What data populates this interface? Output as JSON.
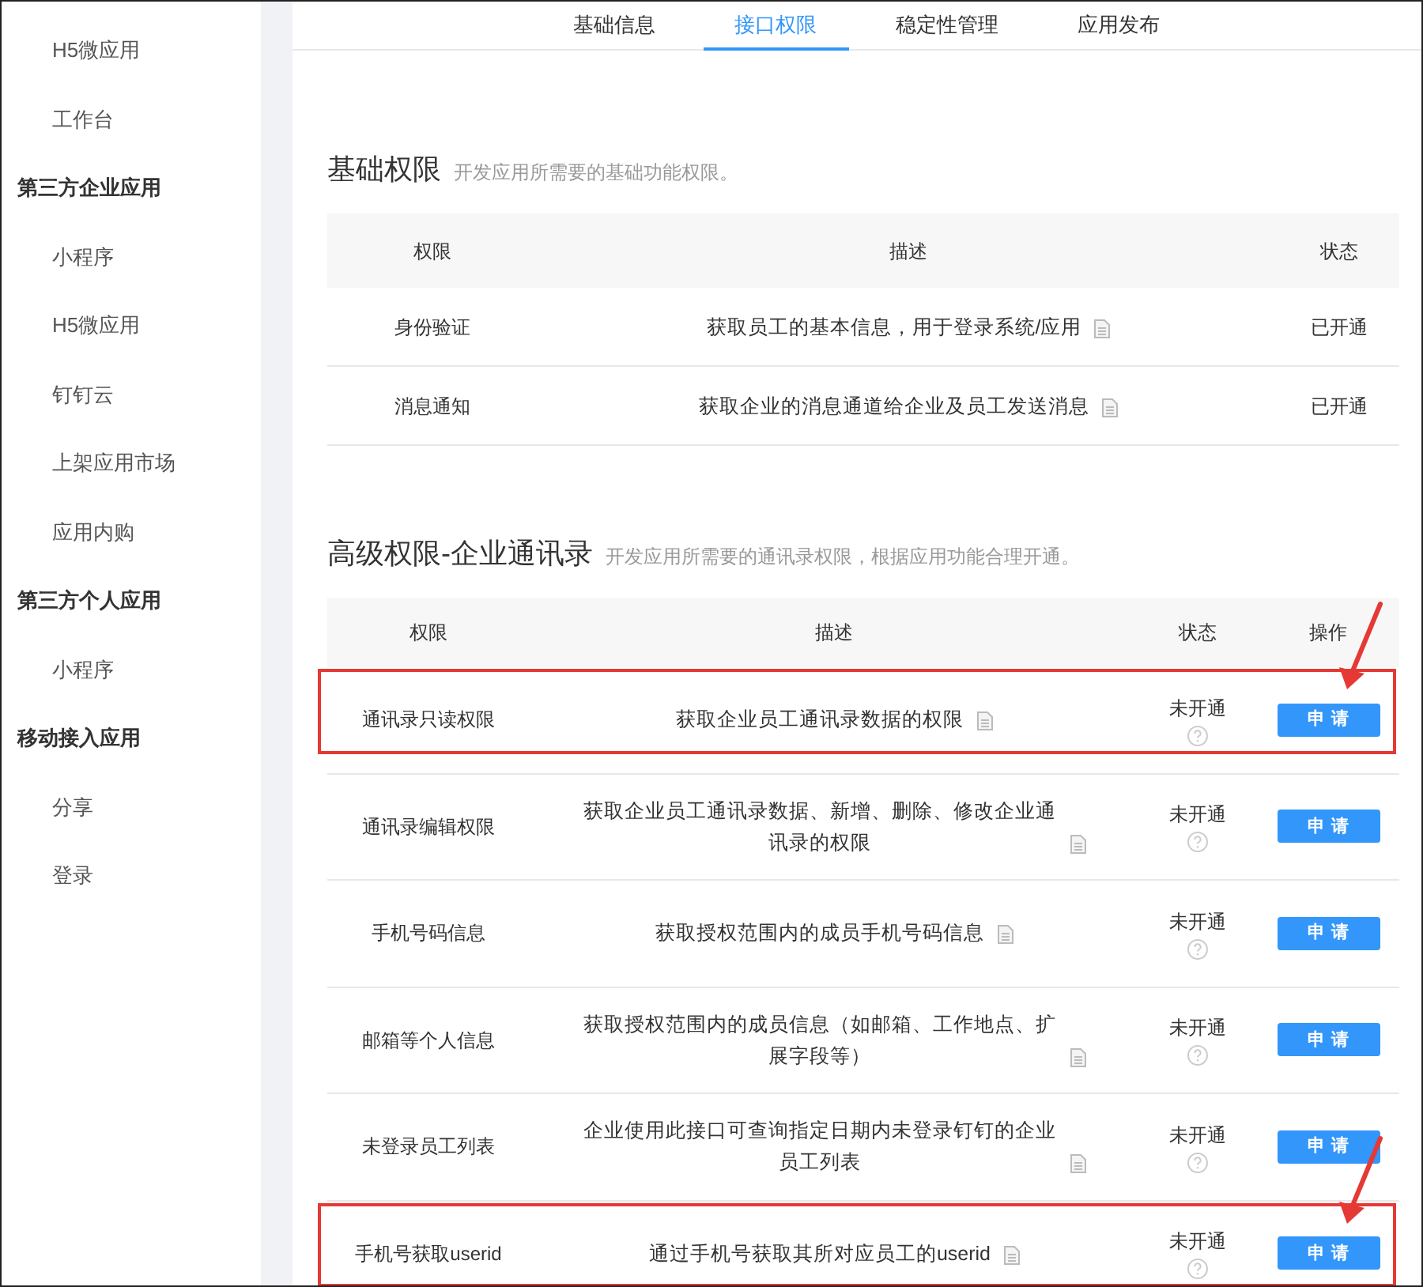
{
  "sidebar": {
    "groups": [
      {
        "children": [
          {
            "label": "H5微应用"
          },
          {
            "label": "工作台"
          }
        ]
      },
      {
        "label": "第三方企业应用",
        "children": [
          {
            "label": "小程序"
          },
          {
            "label": "H5微应用"
          },
          {
            "label": "钉钉云"
          },
          {
            "label": "上架应用市场"
          },
          {
            "label": "应用内购"
          }
        ]
      },
      {
        "label": "第三方个人应用",
        "children": [
          {
            "label": "小程序"
          }
        ]
      },
      {
        "label": "移动接入应用",
        "children": [
          {
            "label": "分享"
          },
          {
            "label": "登录"
          }
        ]
      }
    ]
  },
  "tabs": [
    {
      "label": "基础信息",
      "selected": false
    },
    {
      "label": "接口权限",
      "selected": true
    },
    {
      "label": "稳定性管理",
      "selected": false
    },
    {
      "label": "应用发布",
      "selected": false
    }
  ],
  "sections": [
    {
      "kind": "basic",
      "title": "基础权限",
      "subtitle": "开发应用所需要的基础功能权限。",
      "columns": [
        "权限",
        "描述",
        "状态"
      ],
      "rows": [
        {
          "name": "身份验证",
          "description": "获取员工的基本信息，用于登录系统/应用",
          "status": "已开通",
          "highlighted": false
        },
        {
          "name": "消息通知",
          "description": "获取企业的消息通道给企业及员工发送消息",
          "status": "已开通",
          "highlighted": false
        }
      ]
    },
    {
      "kind": "advanced",
      "title": "高级权限-企业通讯录",
      "subtitle": "开发应用所需要的通讯录权限，根据应用功能合理开通。",
      "columns": [
        "权限",
        "描述",
        "状态",
        "操作"
      ],
      "rows": [
        {
          "name": "通讯录只读权限",
          "description": "获取企业员工通讯录数据的权限",
          "status": "未开通",
          "action": "申请",
          "highlighted": true
        },
        {
          "name": "通讯录编辑权限",
          "description": "获取企业员工通讯录数据、新增、删除、修改企业通讯录的权限",
          "status": "未开通",
          "action": "申请",
          "highlighted": false
        },
        {
          "name": "手机号码信息",
          "description": "获取授权范围内的成员手机号码信息",
          "status": "未开通",
          "action": "申请",
          "highlighted": false
        },
        {
          "name": "邮箱等个人信息",
          "description": "获取授权范围内的成员信息（如邮箱、工作地点、扩展字段等）",
          "status": "未开通",
          "action": "申请",
          "highlighted": false
        },
        {
          "name": "未登录员工列表",
          "description": "企业使用此接口可查询指定日期内未登录钉钉的企业员工列表",
          "status": "未开通",
          "action": "申请",
          "highlighted": false
        },
        {
          "name": "手机号获取userid",
          "description": "通过手机号获取其所对应员工的userid",
          "status": "未开通",
          "action": "申请",
          "highlighted": true
        }
      ]
    }
  ]
}
